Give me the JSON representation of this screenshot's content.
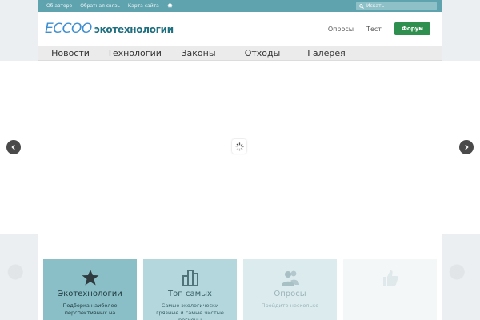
{
  "topbar": {
    "links": [
      "Об авторе",
      "Обратная связь",
      "Карта сайта"
    ],
    "search_placeholder": "Искать"
  },
  "header": {
    "logo_main": "ECCOO",
    "logo_sub": "экотехнологии",
    "links": [
      "Опросы",
      "Тест"
    ],
    "forum_label": "Форум"
  },
  "nav": {
    "items": [
      "Новости",
      "Технологии",
      "Законы",
      "Отходы",
      "Галерея"
    ]
  },
  "cards": [
    {
      "title": "Экотехнологии",
      "desc": "Подборка наиболее перспективных на",
      "icon": "star-icon",
      "bg": "#8bbfc7",
      "color": "#1f3a3f"
    },
    {
      "title": "Топ самых",
      "desc": "Самые экологически грязные и самые чистые регионы",
      "icon": "buildings-icon",
      "bg": "#b3d7dc",
      "color": "#3a6168"
    },
    {
      "title": "Опросы",
      "desc": "Пройдите несколько",
      "icon": "users-icon",
      "bg": "#dcebee",
      "color": "#9bb4b8"
    },
    {
      "title": "",
      "desc": "",
      "icon": "thumbs-up-icon",
      "bg": "#f4f7f8",
      "color": "#dbe4e6"
    }
  ]
}
